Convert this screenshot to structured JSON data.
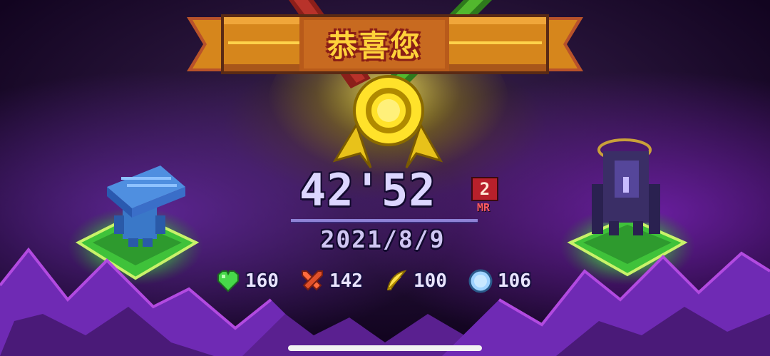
{
  "banner": {
    "title": "恭喜您"
  },
  "result": {
    "time": "42'52",
    "mode": {
      "number": "2",
      "label": "MR"
    },
    "date": "2021/8/9"
  },
  "stats": [
    {
      "icon": "heart-icon",
      "value": "160",
      "color": "#47d84a"
    },
    {
      "icon": "sword-icon",
      "value": "142",
      "color": "#ff6a3d"
    },
    {
      "icon": "feather-icon",
      "value": "100",
      "color": "#ffe04a"
    },
    {
      "icon": "shield-icon",
      "value": "106",
      "color": "#9fd3ff"
    }
  ],
  "colors": {
    "background": "#140624",
    "ribbon_orange": "#d6861c",
    "medal_gold": "#ffe22a",
    "portal_green": "#3ee04a",
    "mountain_purple": "#7b2fc0"
  }
}
